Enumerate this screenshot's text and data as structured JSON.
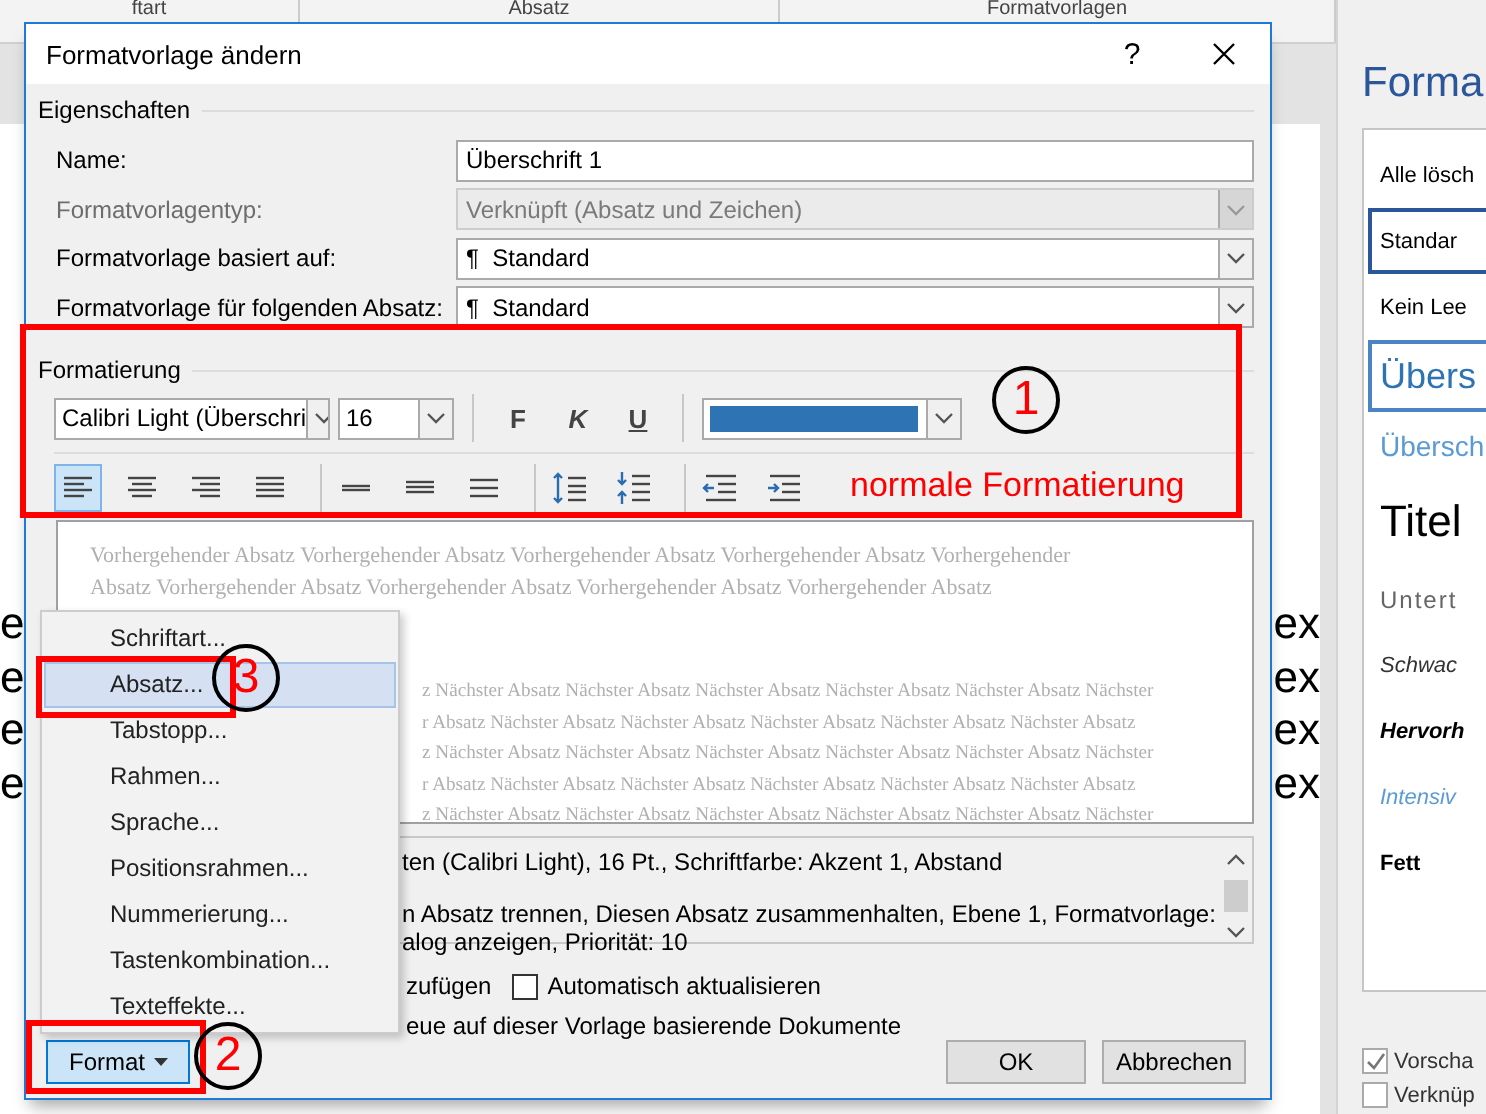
{
  "ribbon": {
    "groups": [
      "ftart",
      "Absatz",
      "Formatvorlagen"
    ]
  },
  "document": {
    "lines": [
      {
        "left": "e",
        "right": "ex"
      },
      {
        "left": "e",
        "right": "ex"
      },
      {
        "left": "e",
        "right": "ex"
      },
      {
        "left": "e",
        "right": "ex"
      }
    ]
  },
  "styles_pane": {
    "title": "Forma",
    "items": [
      {
        "label": "Alle lösch",
        "kind": "plain",
        "selected": false
      },
      {
        "label": "Standar",
        "kind": "plain",
        "selected": true
      },
      {
        "label": "Kein Lee",
        "kind": "plain",
        "selected": false
      },
      {
        "label": "Übers",
        "kind": "heading1",
        "selected": true
      },
      {
        "label": "Übersch",
        "kind": "heading2",
        "selected": false
      },
      {
        "label": "Titel",
        "kind": "title",
        "selected": false
      },
      {
        "label": "Untert",
        "kind": "subtitle",
        "selected": false
      },
      {
        "label": "Schwac",
        "kind": "italic",
        "selected": false
      },
      {
        "label": "Hervorh",
        "kind": "bolditalic",
        "selected": false
      },
      {
        "label": "Intensiv",
        "kind": "blueitalic",
        "selected": false
      },
      {
        "label": "Fett",
        "kind": "bold",
        "selected": false
      }
    ],
    "options": [
      {
        "label": "Vorscha",
        "checked": true
      },
      {
        "label": "Verknüp",
        "checked": false
      }
    ]
  },
  "dialog": {
    "title": "Formatvorlage ändern",
    "help": "?",
    "properties": {
      "heading": "Eigenschaften",
      "fields": [
        {
          "label": "Name:",
          "kind": "text",
          "value": "Überschrift 1",
          "disabled": false
        },
        {
          "label": "Formatvorlagentyp:",
          "kind": "select",
          "value": "Verknüpft (Absatz und Zeichen)",
          "disabled": true
        },
        {
          "label": "Formatvorlage basiert auf:",
          "kind": "select",
          "value": "¶  Standard",
          "disabled": false
        },
        {
          "label": "Formatvorlage für folgenden Absatz:",
          "kind": "select",
          "value": "¶  Standard",
          "disabled": false
        }
      ]
    },
    "formatting": {
      "heading": "Formatierung",
      "font": "Calibri Light (Überschri",
      "size": "16",
      "style_buttons": [
        {
          "label": "F",
          "kind": "bold"
        },
        {
          "label": "K",
          "kind": "italic"
        },
        {
          "label": "U",
          "kind": "underline"
        }
      ],
      "color": "#2e74b5",
      "paragraph_buttons": [
        {
          "kind": "align-left",
          "divider_before": false,
          "selected": true
        },
        {
          "kind": "align-center",
          "divider_before": false,
          "selected": false
        },
        {
          "kind": "align-right",
          "divider_before": false,
          "selected": false
        },
        {
          "kind": "justify",
          "divider_before": false,
          "selected": false
        },
        {
          "kind": "spacing-single",
          "divider_before": true,
          "selected": false
        },
        {
          "kind": "spacing-onehalf",
          "divider_before": false,
          "selected": false
        },
        {
          "kind": "spacing-double",
          "divider_before": false,
          "selected": false
        },
        {
          "kind": "space-more",
          "divider_before": true,
          "selected": false
        },
        {
          "kind": "space-less",
          "divider_before": false,
          "selected": false
        },
        {
          "kind": "indent-less",
          "divider_before": true,
          "selected": false
        },
        {
          "kind": "indent-more",
          "divider_before": false,
          "selected": false
        }
      ]
    },
    "preview": {
      "previous": [
        "Vorhergehender Absatz Vorhergehender Absatz Vorhergehender Absatz Vorhergehender Absatz Vorhergehender",
        "Absatz Vorhergehender Absatz Vorhergehender Absatz Vorhergehender Absatz Vorhergehender Absatz"
      ],
      "next": [
        "z Nächster Absatz Nächster Absatz Nächster Absatz Nächster Absatz Nächster Absatz Nächster",
        "r Absatz Nächster Absatz Nächster Absatz Nächster Absatz Nächster Absatz Nächster Absatz",
        "z Nächster Absatz Nächster Absatz Nächster Absatz Nächster Absatz Nächster Absatz Nächster",
        "r Absatz Nächster Absatz Nächster Absatz Nächster Absatz Nächster Absatz Nächster Absatz",
        "z Nächster Absatz Nächster Absatz Nächster Absatz Nächster Absatz Nächster Absatz Nächster"
      ]
    },
    "description": [
      "ten (Calibri Light), 16 Pt., Schriftfarbe: Akzent 1, Abstand",
      "n Absatz trennen, Diesen Absatz zusammenhalten, Ebene 1, Formatvorlage:",
      "alog anzeigen, Priorität: 10"
    ],
    "options": [
      {
        "label": "zufügen",
        "kind": "text"
      },
      {
        "label": "Automatisch aktualisieren",
        "kind": "checkbox",
        "checked": false
      }
    ],
    "scope": "eue auf dieser Vorlage basierende Dokumente",
    "format_button": "Format",
    "buttons": [
      "OK",
      "Abbrechen"
    ],
    "menu": [
      {
        "label": "Schriftart...",
        "selected": false
      },
      {
        "label": "Absatz...",
        "selected": true
      },
      {
        "label": "Tabstopp...",
        "selected": false
      },
      {
        "label": "Rahmen...",
        "selected": false
      },
      {
        "label": "Sprache...",
        "selected": false
      },
      {
        "label": "Positionsrahmen...",
        "selected": false
      },
      {
        "label": "Nummerierung...",
        "selected": false
      },
      {
        "label": "Tastenkombination...",
        "selected": false
      },
      {
        "label": "Texteffekte...",
        "selected": false
      }
    ]
  },
  "annotations": [
    {
      "number": "1",
      "label": "normale Formatierung"
    },
    {
      "number": "3"
    },
    {
      "number": "2"
    }
  ]
}
